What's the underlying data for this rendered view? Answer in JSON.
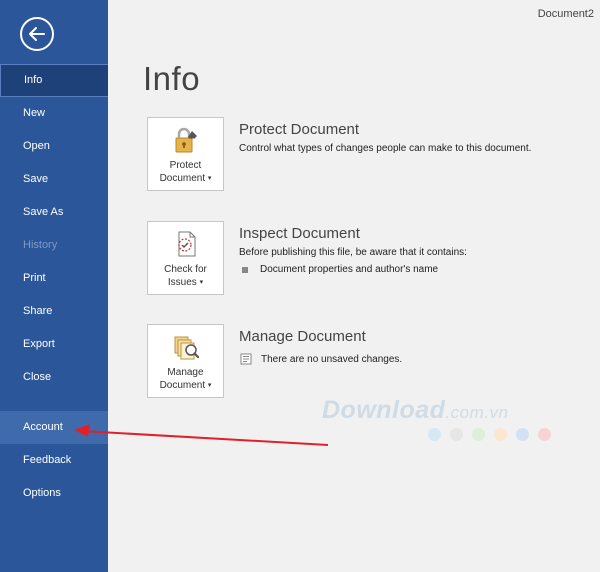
{
  "window": {
    "document_title": "Document2"
  },
  "sidebar": {
    "items": [
      {
        "label": "Info",
        "state": "active"
      },
      {
        "label": "New",
        "state": "normal"
      },
      {
        "label": "Open",
        "state": "normal"
      },
      {
        "label": "Save",
        "state": "normal"
      },
      {
        "label": "Save As",
        "state": "normal"
      },
      {
        "label": "History",
        "state": "disabled"
      },
      {
        "label": "Print",
        "state": "normal"
      },
      {
        "label": "Share",
        "state": "normal"
      },
      {
        "label": "Export",
        "state": "normal"
      },
      {
        "label": "Close",
        "state": "normal"
      },
      {
        "label": "Account",
        "state": "highlight"
      },
      {
        "label": "Feedback",
        "state": "normal"
      },
      {
        "label": "Options",
        "state": "normal"
      }
    ]
  },
  "main": {
    "title": "Info",
    "protect": {
      "tile_line1": "Protect",
      "tile_line2": "Document",
      "heading": "Protect Document",
      "description": "Control what types of changes people can make to this document."
    },
    "inspect": {
      "tile_line1": "Check for",
      "tile_line2": "Issues",
      "heading": "Inspect Document",
      "description": "Before publishing this file, be aware that it contains:",
      "bullet": "Document properties and author's name"
    },
    "manage": {
      "tile_line1": "Manage",
      "tile_line2": "Document",
      "heading": "Manage Document",
      "note": "There are no unsaved changes."
    }
  },
  "watermark": {
    "text": "Download",
    "suffix": ".com.vn",
    "dot_colors": [
      "#d5e8f5",
      "#e6e6e6",
      "#dcefd8",
      "#fbe7cf",
      "#d3e2f3",
      "#f6d4d4"
    ]
  },
  "colors": {
    "sidebar": "#2b579a",
    "active": "#1e4179",
    "arrow": "#e0212b"
  },
  "caret": "▾"
}
